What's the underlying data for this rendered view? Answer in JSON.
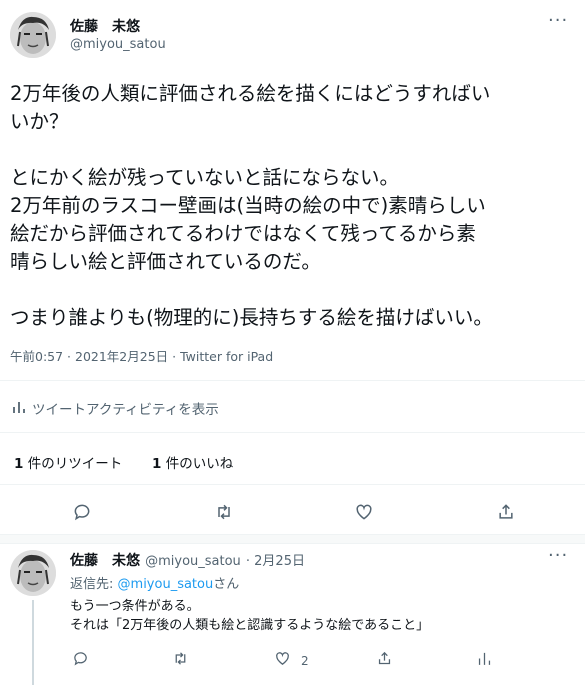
{
  "tweet": {
    "author_name": "佐藤　未悠",
    "author_handle": "@miyou_satou",
    "text": "2万年後の人類に評価される絵を描くにはどうすればい\nいか？\n\nとにかく絵が残っていないと話にならない。\n2万年前のラスコー壁画は(当時の絵の中で)素晴らしい\n絵だから評価されてるわけではなくて残ってるから素\n晴らしい絵と評価されているのだ。\n\nつまり誰よりも(物理的に)長持ちする絵を描けばいい。",
    "timestamp": "午前0:57 · 2021年2月25日 · Twitter for iPad",
    "activity_label": "ツイートアクティビティを表示",
    "retweets_count": "1",
    "retweets_label": "件のリツイート",
    "likes_count": "1",
    "likes_label": "件のいいね"
  },
  "reply": {
    "author_name": "佐藤　未悠",
    "author_handle": "@miyou_satou",
    "date": "· 2月25日",
    "replying_prefix": "返信先:",
    "replying_handle": "@miyou_satou",
    "replying_suffix": "さん",
    "text": "もう一つ条件がある。\nそれは「2万年後の人類も絵と認識するような絵であること」",
    "like_count": "2"
  },
  "icons": [
    "more-icon",
    "activity-icon",
    "reply-icon",
    "retweet-icon",
    "like-icon",
    "share-icon"
  ],
  "colors": {
    "text": "#0f1419",
    "secondary": "#536471",
    "link": "#1d9bf0",
    "divider": "#eff3f4"
  }
}
